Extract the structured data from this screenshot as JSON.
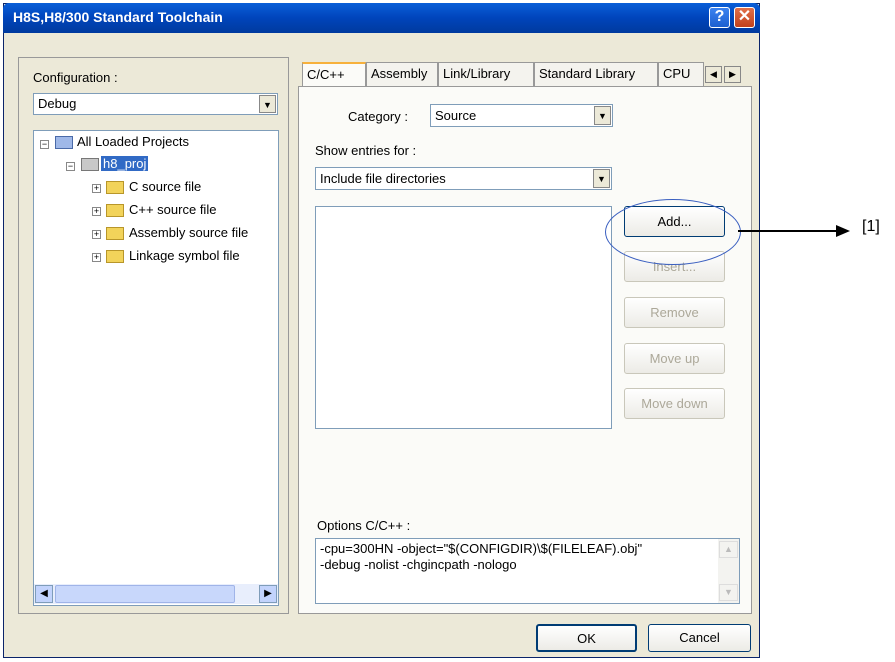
{
  "window": {
    "title": "H8S,H8/300 Standard Toolchain",
    "help_label": "?",
    "close_label": "✕"
  },
  "left": {
    "config_label": "Configuration :",
    "config_value": "Debug",
    "tree": {
      "root": "All Loaded Projects",
      "project": "h8_proj",
      "children": [
        "C source file",
        "C++ source file",
        "Assembly source file",
        "Linkage symbol file"
      ]
    }
  },
  "tabs": [
    "C/C++",
    "Assembly",
    "Link/Library",
    "Standard Library",
    "CPU"
  ],
  "main": {
    "category_label": "Category :",
    "category_value": "Source",
    "show_entries_label": "Show entries for :",
    "show_entries_value": "Include file directories",
    "buttons": {
      "add": "Add...",
      "insert": "Insert...",
      "remove": "Remove",
      "move_up": "Move up",
      "move_down": "Move down"
    },
    "options_label": "Options C/C++ :",
    "options_lines": [
      "-cpu=300HN -object=\"$(CONFIGDIR)\\$(FILELEAF).obj\"",
      "-debug -nolist -chgincpath -nologo"
    ]
  },
  "footer": {
    "ok": "OK",
    "cancel": "Cancel"
  },
  "annotation": {
    "label": "[1]"
  }
}
